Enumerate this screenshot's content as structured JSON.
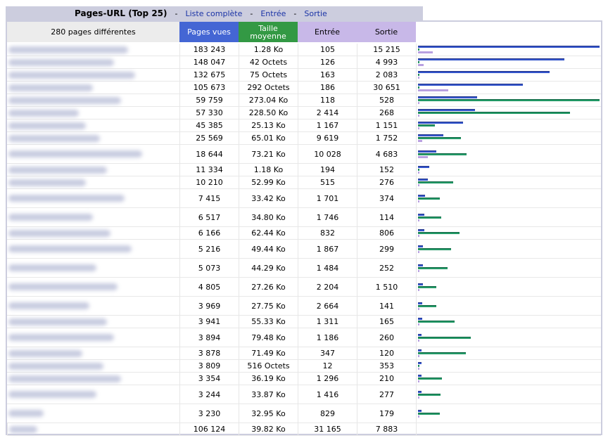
{
  "titlebar": {
    "title": "Pages-URL (Top 25)",
    "sep": "-",
    "link_full": "Liste complète",
    "link_entry": "Entrée",
    "link_exit": "Sortie"
  },
  "header": {
    "count": "280 pages différentes",
    "pages": "Pages vues",
    "size_line1": "Taille",
    "size_line2": "moyenne",
    "entry": "Entrée",
    "exit": "Sortie"
  },
  "colors": {
    "pages": "#4466d4",
    "size": "#339944",
    "entry": "#c8b8e8",
    "header_bg": "#cccdde"
  },
  "rows": [
    {
      "pages": "183 243",
      "size": "1.28 Ko",
      "entry": "105",
      "exit": "15 215",
      "bar_pages": 1.0,
      "bar_size": 0.0,
      "bar_entry": 0.083
    },
    {
      "pages": "148 047",
      "size": "42 Octets",
      "entry": "126",
      "exit": "4 993",
      "bar_pages": 0.808,
      "bar_size": 0.0,
      "bar_entry": 0.031
    },
    {
      "pages": "132 675",
      "size": "75 Octets",
      "entry": "163",
      "exit": "2 083",
      "bar_pages": 0.724,
      "bar_size": 0.0,
      "bar_entry": 0.008
    },
    {
      "pages": "105 673",
      "size": "292 Octets",
      "entry": "186",
      "exit": "30 651",
      "bar_pages": 0.577,
      "bar_size": 0.0,
      "bar_entry": 0.167
    },
    {
      "pages": "59 759",
      "size": "273.04 Ko",
      "entry": "118",
      "exit": "528",
      "bar_pages": 0.326,
      "bar_size": 1.0,
      "bar_entry": 0.004
    },
    {
      "pages": "57 330",
      "size": "228.50 Ko",
      "entry": "2 414",
      "exit": "268",
      "bar_pages": 0.313,
      "bar_size": 0.837,
      "bar_entry": 0.003
    },
    {
      "pages": "45 385",
      "size": "25.13 Ko",
      "entry": "1 167",
      "exit": "1 151",
      "bar_pages": 0.248,
      "bar_size": 0.092,
      "bar_entry": 0.003
    },
    {
      "pages": "25 569",
      "size": "65.01 Ko",
      "entry": "9 619",
      "exit": "1 752",
      "bar_pages": 0.14,
      "bar_size": 0.238,
      "bar_entry": 0.024
    },
    {
      "pages": "18 644",
      "size": "73.21 Ko",
      "entry": "10 028",
      "exit": "4 683",
      "bar_pages": 0.102,
      "bar_size": 0.268,
      "bar_entry": 0.055
    },
    {
      "pages": "11 334",
      "size": "1.18 Ko",
      "entry": "194",
      "exit": "152",
      "bar_pages": 0.062,
      "bar_size": 0.004,
      "bar_entry": 0.004
    },
    {
      "pages": "10 210",
      "size": "52.99 Ko",
      "entry": "515",
      "exit": "276",
      "bar_pages": 0.056,
      "bar_size": 0.194,
      "bar_entry": 0.004
    },
    {
      "pages": "7 415",
      "size": "33.42 Ko",
      "entry": "1 701",
      "exit": "374",
      "bar_pages": 0.04,
      "bar_size": 0.122,
      "bar_entry": 0.004
    },
    {
      "pages": "6 517",
      "size": "34.80 Ko",
      "entry": "1 746",
      "exit": "114",
      "bar_pages": 0.036,
      "bar_size": 0.127,
      "bar_entry": 0.004
    },
    {
      "pages": "6 166",
      "size": "62.44 Ko",
      "entry": "832",
      "exit": "806",
      "bar_pages": 0.034,
      "bar_size": 0.229,
      "bar_entry": 0.004
    },
    {
      "pages": "5 216",
      "size": "49.44 Ko",
      "entry": "1 867",
      "exit": "299",
      "bar_pages": 0.028,
      "bar_size": 0.181,
      "bar_entry": 0.004
    },
    {
      "pages": "5 073",
      "size": "44.29 Ko",
      "entry": "1 484",
      "exit": "252",
      "bar_pages": 0.028,
      "bar_size": 0.162,
      "bar_entry": 0.004
    },
    {
      "pages": "4 805",
      "size": "27.26 Ko",
      "entry": "2 204",
      "exit": "1 510",
      "bar_pages": 0.026,
      "bar_size": 0.1,
      "bar_entry": 0.004
    },
    {
      "pages": "3 969",
      "size": "27.75 Ko",
      "entry": "2 664",
      "exit": "141",
      "bar_pages": 0.022,
      "bar_size": 0.102,
      "bar_entry": 0.004
    },
    {
      "pages": "3 941",
      "size": "55.33 Ko",
      "entry": "1 311",
      "exit": "165",
      "bar_pages": 0.022,
      "bar_size": 0.203,
      "bar_entry": 0.004
    },
    {
      "pages": "3 894",
      "size": "79.48 Ko",
      "entry": "1 186",
      "exit": "260",
      "bar_pages": 0.021,
      "bar_size": 0.291,
      "bar_entry": 0.004
    },
    {
      "pages": "3 878",
      "size": "71.49 Ko",
      "entry": "347",
      "exit": "120",
      "bar_pages": 0.021,
      "bar_size": 0.262,
      "bar_entry": 0.004
    },
    {
      "pages": "3 809",
      "size": "516 Octets",
      "entry": "12",
      "exit": "353",
      "bar_pages": 0.021,
      "bar_size": 0.002,
      "bar_entry": 0.004
    },
    {
      "pages": "3 354",
      "size": "36.19 Ko",
      "entry": "1 296",
      "exit": "210",
      "bar_pages": 0.018,
      "bar_size": 0.133,
      "bar_entry": 0.004
    },
    {
      "pages": "3 244",
      "size": "33.87 Ko",
      "entry": "1 416",
      "exit": "277",
      "bar_pages": 0.018,
      "bar_size": 0.124,
      "bar_entry": 0.004
    },
    {
      "pages": "3 230",
      "size": "32.95 Ko",
      "entry": "829",
      "exit": "179",
      "bar_pages": 0.018,
      "bar_size": 0.121,
      "bar_entry": 0.004
    }
  ],
  "total": {
    "pages": "106 124",
    "size": "39.82 Ko",
    "entry": "31 165",
    "exit": "7 883"
  }
}
